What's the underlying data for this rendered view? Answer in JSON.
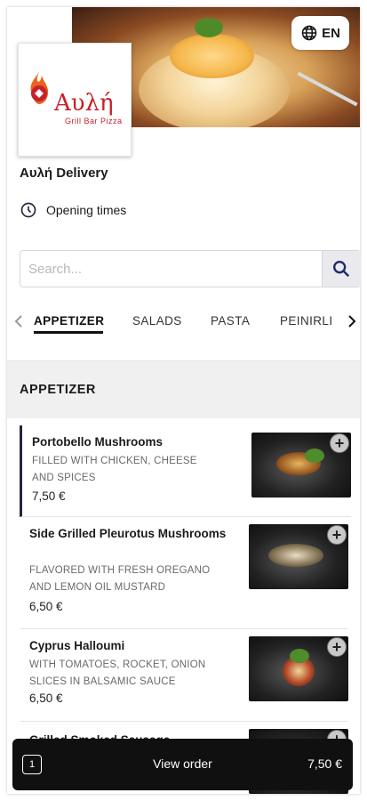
{
  "language_button": {
    "label": "EN",
    "icon": "globe-icon"
  },
  "logo": {
    "brand_name": "Αυλή",
    "tagline": "Grill Bar Pizza"
  },
  "restaurant": {
    "title": "Αυλή Delivery",
    "opening_label": "Opening times"
  },
  "search": {
    "placeholder": "Search...",
    "icon": "search-icon"
  },
  "categories": {
    "tabs": [
      "APPETIZER",
      "SALADS",
      "PASTA",
      "PEINIRLI"
    ],
    "active": "APPETIZER"
  },
  "section": {
    "title": "APPETIZER"
  },
  "items": [
    {
      "name": "Portobello Mushrooms",
      "description": "FILLED WITH CHICKEN, CHEESE AND SPICES",
      "price": "7,50 €"
    },
    {
      "name": "Side Grilled Pleurotus Mushrooms",
      "description": "FLAVORED WITH FRESH OREGANO AND LEMON OIL MUSTARD",
      "price": "6,50 €"
    },
    {
      "name": "Cyprus Halloumi",
      "description": "WITH TOMATOES, ROCKET, ONION SLICES IN BALSAMIC SAUCE",
      "price": "6,50 €"
    },
    {
      "name": "Grilled Smoked Sausage",
      "description": "",
      "price": ""
    }
  ],
  "order_bar": {
    "count": "1",
    "label": "View order",
    "total": "7,50 €"
  },
  "colors": {
    "accent": "#25253d",
    "brand_red": "#c8202a",
    "bar": "#101010"
  }
}
